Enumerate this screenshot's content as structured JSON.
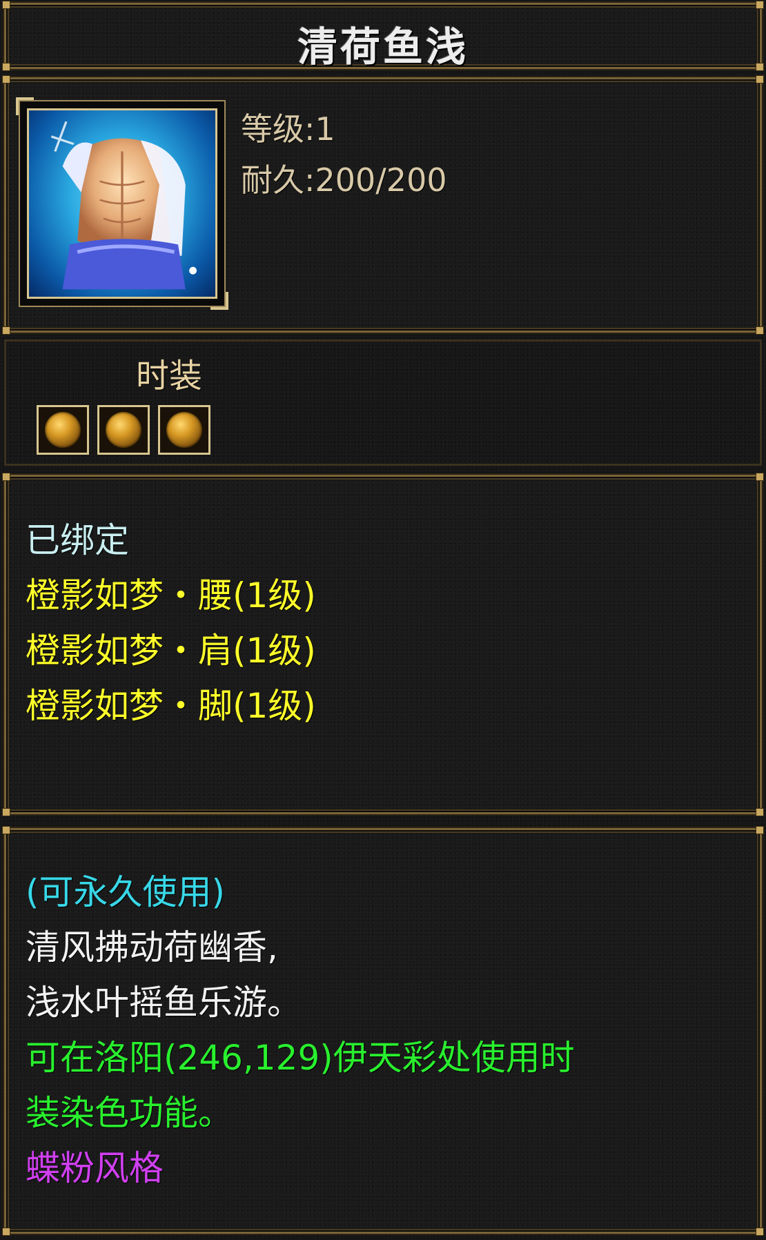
{
  "title": "清荷鱼浅",
  "stats": {
    "level": "等级:1",
    "durability": "耐久:200/200"
  },
  "portrait": {
    "icon": "fashion-outfit-icon"
  },
  "item_type": "时装",
  "sockets": [
    {
      "icon": "socket-gem-icon"
    },
    {
      "icon": "socket-gem-icon"
    },
    {
      "icon": "socket-gem-icon"
    }
  ],
  "properties": {
    "bound": "已绑定",
    "set_items": [
      "橙影如梦・腰(1级)",
      "橙影如梦・肩(1级)",
      "橙影如梦・脚(1级)"
    ]
  },
  "description": {
    "usage": "(可永久使用)",
    "poem_line_1": "清风拂动荷幽香,",
    "poem_line_2": "浅水叶摇鱼乐游。",
    "hint_line_1": "可在洛阳(246,129)伊天彩处使用时",
    "hint_line_2": "装染色功能。",
    "style": "蝶粉风格"
  },
  "colors": {
    "set_items": "#ffff2a",
    "usage": "#38d8e8",
    "hint": "#29f02e",
    "style": "#d040f0",
    "bound": "#c9eef0"
  }
}
